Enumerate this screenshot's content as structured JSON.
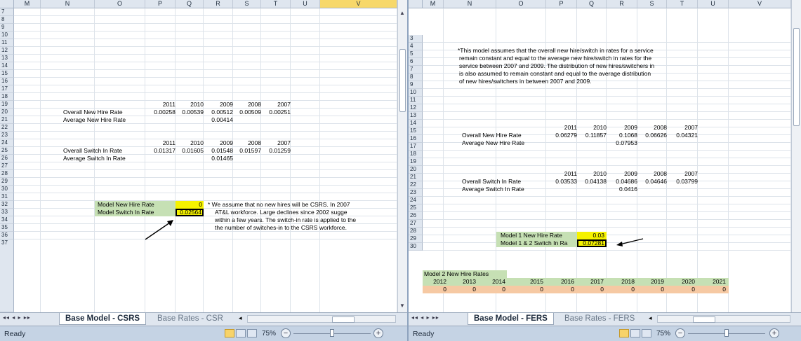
{
  "left": {
    "columns": [
      "M",
      "N",
      "O",
      "P",
      "Q",
      "R",
      "S",
      "T",
      "U",
      "V"
    ],
    "selected_column": "V",
    "rows": [
      "7",
      "8",
      "9",
      "10",
      "11",
      "12",
      "13",
      "14",
      "15",
      "16",
      "17",
      "18",
      "19",
      "20",
      "21",
      "22",
      "23",
      "24",
      "25",
      "26",
      "27",
      "28",
      "29",
      "30",
      "31",
      "32",
      "33",
      "34",
      "35",
      "36"
    ],
    "partial_row": "37",
    "years": [
      "2011",
      "2010",
      "2009",
      "2008",
      "2007"
    ],
    "hire_years": [
      "2011",
      "2010",
      "2009",
      "2008",
      "2007"
    ],
    "overall_new_hire_label": "Overall New Hire Rate",
    "overall_new_hire_values": [
      "0.00258",
      "0.00539",
      "0.00512",
      "0.00509",
      "0.00251"
    ],
    "average_new_hire_label": "Average New Hire Rate",
    "average_new_hire_value": "0.00414",
    "overall_switch_label": "Overall Switch In Rate",
    "overall_switch_values": [
      "0.01317",
      "0.01605",
      "0.01548",
      "0.01597",
      "0.01259"
    ],
    "average_switch_label": "Average Switch In Rate",
    "average_switch_value": "0.01465",
    "model_new_hire_label": "Model New Hire Rate",
    "model_new_hire_value": "0",
    "model_switch_label": "Model Switch In Rate",
    "model_switch_value": "0.02564",
    "note_lines": [
      "* We assume that no new hires will be CSRS.  In 2007",
      "AT&L workforce.  Large declines since 2002 sugge",
      "within a few years. The switch-in rate is applied to the",
      "the number of switches-in to the CSRS workforce."
    ],
    "tabs": [
      "Base Model - CSRS",
      "Base Rates - CSR"
    ],
    "status": "Ready",
    "zoom": "75%"
  },
  "right": {
    "columns": [
      "M",
      "N",
      "O",
      "P",
      "Q",
      "R",
      "S",
      "T",
      "U",
      "V"
    ],
    "rows": [
      "3",
      "4",
      "5",
      "6",
      "7",
      "8",
      "9",
      "10",
      "11",
      "12",
      "13",
      "14",
      "15",
      "16",
      "17",
      "18",
      "19",
      "20",
      "21",
      "22",
      "23",
      "24",
      "25",
      "26",
      "27",
      "28",
      "29",
      "30"
    ],
    "note_lines": [
      "*This model assumes that the overall new hire/switch in rates for a service",
      "remain constant and equal to the average new hire/switch in rates for the",
      "service between 2007 and 2009.  The distribution of new hires/switchers in",
      "is also assumed to remain constant and equal to the average distribution",
      "of new hires/switchers in between 2007 and 2009."
    ],
    "years": [
      "2011",
      "2010",
      "2009",
      "2008",
      "2007"
    ],
    "switch_years": [
      "2011",
      "2010",
      "2009",
      "2008",
      "2007"
    ],
    "overall_new_hire_label": "Overall New Hire Rate",
    "overall_new_hire_values": [
      "0.06279",
      "0.11857",
      "0.1068",
      "0.06626",
      "0.04321"
    ],
    "average_new_hire_label": "Average New Hire Rate",
    "average_new_hire_value": "0.07953",
    "overall_switch_label": "Overall Switch In Rate",
    "overall_switch_values": [
      "0.03533",
      "0.04138",
      "0.04686",
      "0.04646",
      "0.03799"
    ],
    "average_switch_label": "Average Switch In Rate",
    "average_switch_value": "0.0416",
    "model1_new_hire_label": "Model 1 New Hire Rate",
    "model1_new_hire_value": "0.03",
    "model12_switch_label": "Model 1 & 2 Switch In Ra",
    "model12_switch_value": "0.07281",
    "model2_title": "Model 2 New Hire Rates",
    "model2_years": [
      "2012",
      "2013",
      "2014",
      "2015",
      "2016",
      "2017",
      "2018",
      "2019",
      "2020",
      "2021"
    ],
    "model2_values": [
      "0",
      "0",
      "0",
      "0",
      "0",
      "0",
      "0",
      "0",
      "0",
      "0"
    ],
    "tabs": [
      "Base Model - FERS",
      "Base Rates - FERS"
    ],
    "status": "Ready",
    "zoom": "75%"
  },
  "colors": {
    "header_bg": "#dfe6ef",
    "green_fill": "#c6e0b4",
    "yellow_fill": "#f5f200",
    "orange_fill": "#f6c9a3",
    "status_bg": "#c5d3e4"
  }
}
